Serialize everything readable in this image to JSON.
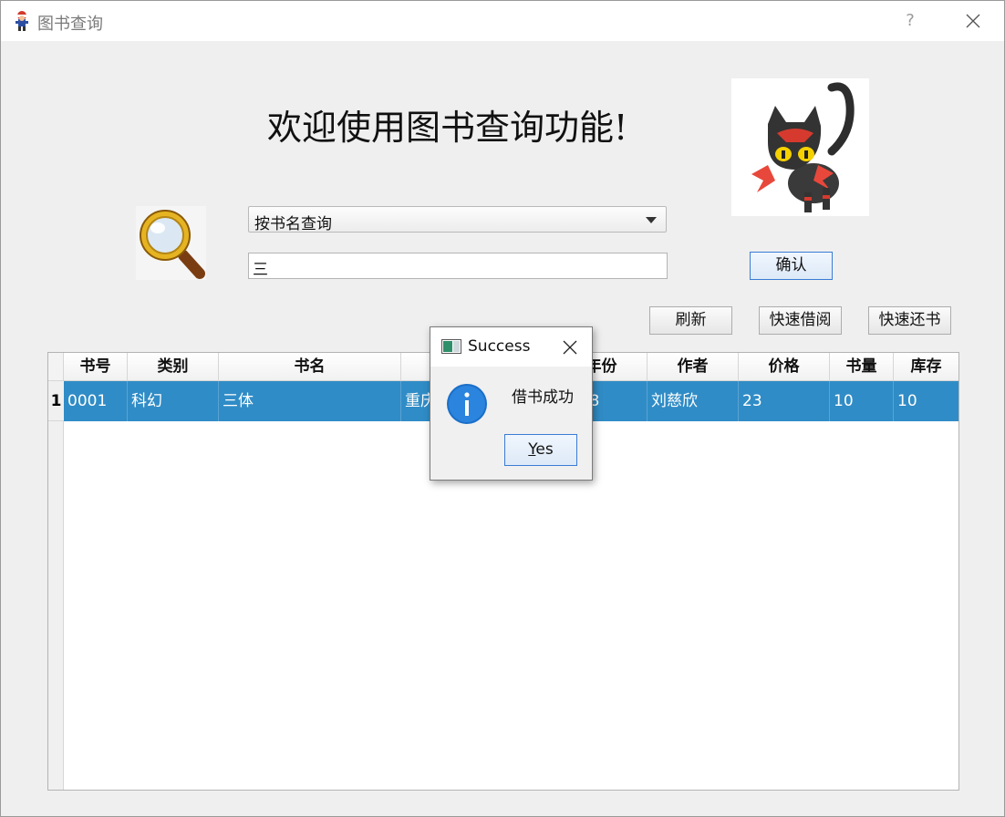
{
  "window": {
    "title": "图书查询",
    "help": "?"
  },
  "welcome": "欢迎使用图书查询功能!",
  "search": {
    "mode_selected": "按书名查询",
    "input_value": "三",
    "confirm_label": "确认"
  },
  "actions": {
    "refresh": "刷新",
    "quick_borrow": "快速借阅",
    "quick_return": "快速还书"
  },
  "table": {
    "headers": [
      "书号",
      "类别",
      "书名",
      "",
      "年份",
      "作者",
      "价格",
      "书量",
      "库存"
    ],
    "rows": [
      {
        "num": "1",
        "cells": [
          "0001",
          "科幻",
          "三体",
          "重庆",
          "2008",
          "刘慈欣",
          "23",
          "10",
          "10"
        ]
      }
    ],
    "selected_color": "#308cc6"
  },
  "dialog": {
    "title": "Success",
    "message": "借书成功",
    "yes_label": "Yes",
    "icon": "info-icon"
  }
}
